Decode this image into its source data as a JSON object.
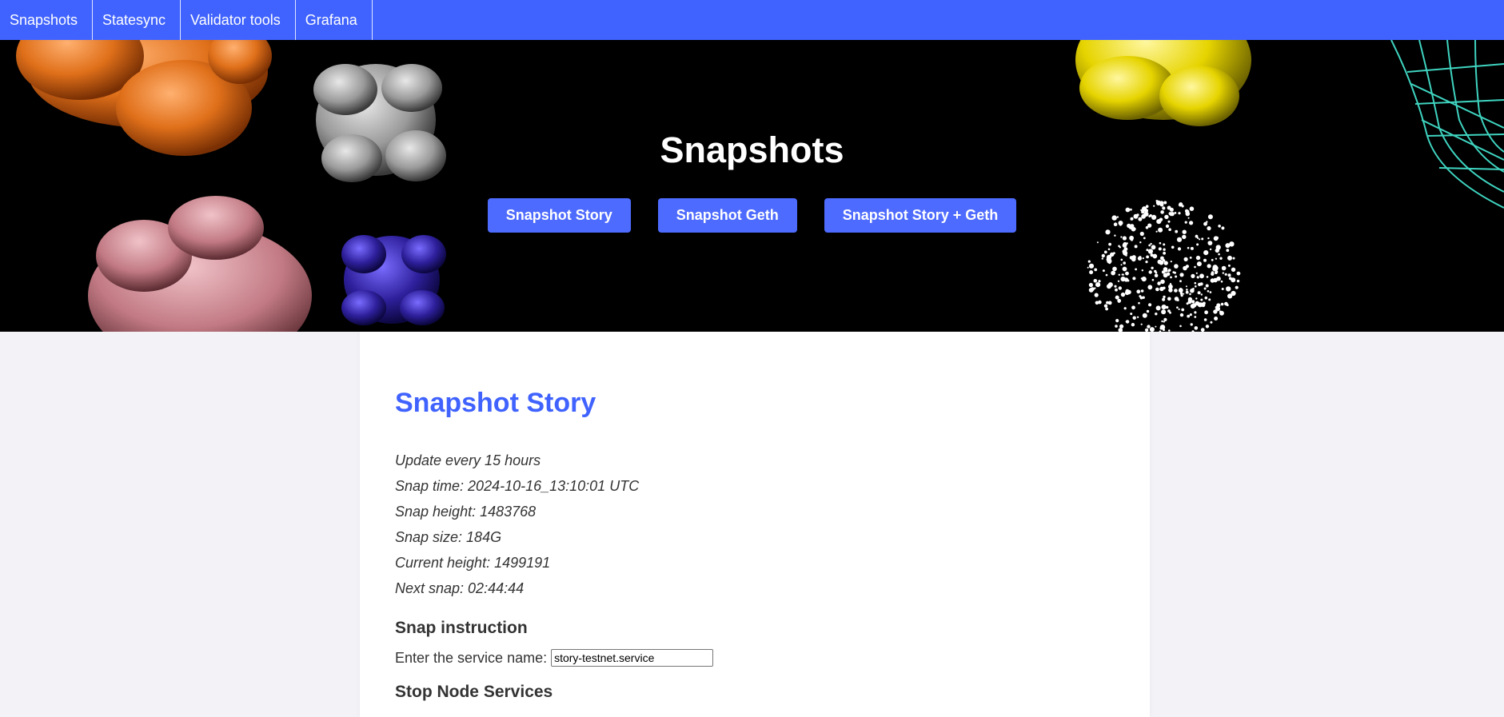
{
  "nav": {
    "items": [
      "Snapshots",
      "Statesync",
      "Validator tools",
      "Grafana"
    ]
  },
  "hero": {
    "title": "Snapshots",
    "buttons": [
      "Snapshot Story",
      "Snapshot Geth",
      "Snapshot Story + Geth"
    ]
  },
  "section": {
    "title": "Snapshot Story",
    "info": [
      "Update every 15 hours",
      "Snap time: 2024-10-16_13:10:01 UTC",
      "Snap height: 1483768",
      "Snap size: 184G",
      "Current height: 1499191",
      "Next snap: 02:44:44"
    ],
    "instruction_title": "Snap instruction",
    "service_label": "Enter the service name:",
    "service_value": "story-testnet.service",
    "stop_title": "Stop Node Services"
  },
  "colors": {
    "nav_bg": "#4063ff",
    "button_bg": "#4e6bff",
    "title_accent": "#4063ff"
  }
}
